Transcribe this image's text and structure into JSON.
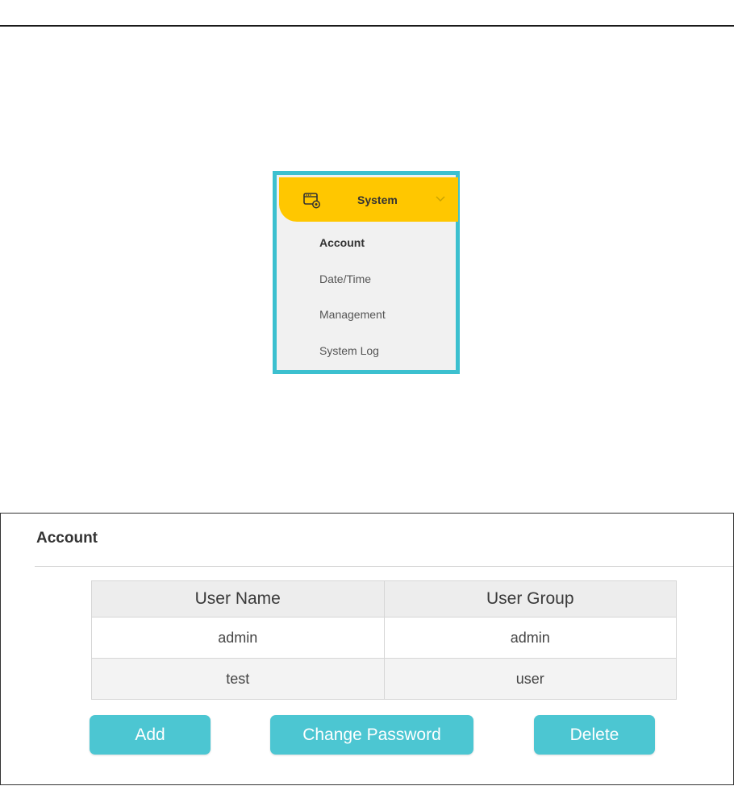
{
  "menu": {
    "header_label": "System",
    "header_icon": "system-settings-icon",
    "accent_color": "#ffc700",
    "frame_color": "#3cc0cf",
    "items": [
      {
        "label": "Account",
        "active": true
      },
      {
        "label": "Date/Time",
        "active": false
      },
      {
        "label": "Management",
        "active": false
      },
      {
        "label": "System Log",
        "active": false
      }
    ]
  },
  "account": {
    "title": "Account",
    "columns": [
      "User Name",
      "User Group"
    ],
    "rows": [
      {
        "user_name": "admin",
        "user_group": "admin"
      },
      {
        "user_name": "test",
        "user_group": "user"
      }
    ],
    "buttons": {
      "add": "Add",
      "change_password": "Change Password",
      "delete": "Delete"
    },
    "button_color": "#4cc6d2"
  }
}
